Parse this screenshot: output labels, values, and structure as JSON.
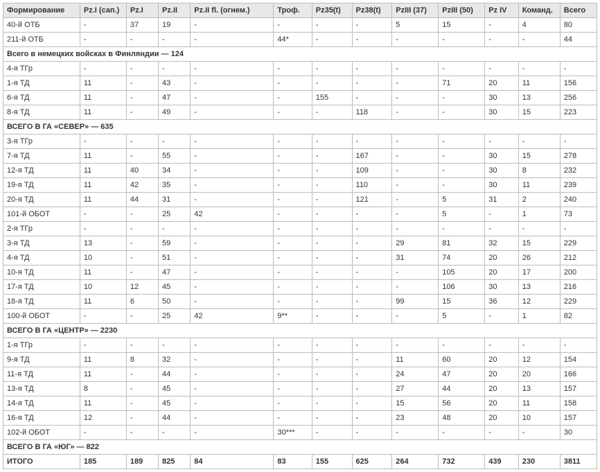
{
  "chart_data": {
    "type": "table",
    "columns": [
      "Формирование",
      "Pz.I (сап.)",
      "Pz.I",
      "Pz.II",
      "Pz.II fl. (огнем.)",
      "Троф.",
      "Pz35(t)",
      "Pz38(t)",
      "PzIII (37)",
      "PzIII (50)",
      "Pz IV",
      "Команд.",
      "Всего"
    ],
    "rows": [
      {
        "t": "d",
        "v": [
          "40-й ОТБ",
          "-",
          "37",
          "19",
          "-",
          "-",
          "-",
          "-",
          "5",
          "15",
          "-",
          "4",
          "80"
        ]
      },
      {
        "t": "d",
        "v": [
          "211-й ОТБ",
          "-",
          "-",
          "-",
          "-",
          "44*",
          "-",
          "-",
          "-",
          "-",
          "-",
          "-",
          "44"
        ]
      },
      {
        "t": "s",
        "label": "Всего в немецких войсках в Финляндии — 124"
      },
      {
        "t": "d",
        "v": [
          "4-я ТГр",
          "-",
          "-",
          "-",
          "-",
          "-",
          "-",
          "-",
          "-",
          "-",
          "-",
          "-",
          "-"
        ]
      },
      {
        "t": "d",
        "v": [
          "1-я ТД",
          "11",
          "-",
          "43",
          "-",
          "-",
          "-",
          "-",
          "-",
          "71",
          "20",
          "11",
          "156"
        ]
      },
      {
        "t": "d",
        "v": [
          "6-я ТД",
          "11",
          "-",
          "47",
          "-",
          "-",
          "155",
          "-",
          "-",
          "-",
          "30",
          "13",
          "256"
        ]
      },
      {
        "t": "d",
        "v": [
          "8-я ТД",
          "11",
          "-",
          "49",
          "-",
          "-",
          "-",
          "118",
          "-",
          "-",
          "30",
          "15",
          "223"
        ]
      },
      {
        "t": "s",
        "label": "ВСЕГО В ГА «СЕВЕР» — 635"
      },
      {
        "t": "d",
        "v": [
          "3-я ТГр",
          "-",
          "-",
          "-",
          "-",
          "-",
          "-",
          "-",
          "-",
          "-",
          "-",
          "-",
          "-"
        ]
      },
      {
        "t": "d",
        "v": [
          "7-я ТД",
          "11",
          "-",
          "55",
          "-",
          "-",
          "-",
          "167",
          "-",
          "-",
          "30",
          "15",
          "278"
        ]
      },
      {
        "t": "d",
        "v": [
          "12-я ТД",
          "11",
          "40",
          "34",
          "-",
          "-",
          "-",
          "109",
          "-",
          "-",
          "30",
          "8",
          "232"
        ]
      },
      {
        "t": "d",
        "v": [
          "19-я ТД",
          "11",
          "42",
          "35",
          "-",
          "-",
          "-",
          "110",
          "-",
          "-",
          "30",
          "11",
          "239"
        ]
      },
      {
        "t": "d",
        "v": [
          "20-я ТД",
          "11",
          "44",
          "31",
          "-",
          "-",
          "-",
          "121",
          "-",
          "5",
          "31",
          "2",
          "240"
        ]
      },
      {
        "t": "d",
        "v": [
          "101-й ОБОТ",
          "-",
          "-",
          "25",
          "42",
          "-",
          "-",
          "-",
          "-",
          "5",
          "-",
          "1",
          "73"
        ]
      },
      {
        "t": "d",
        "v": [
          "2-я ТГр",
          "-",
          "-",
          "-",
          "-",
          "-",
          "-",
          "-",
          "-",
          "-",
          "-",
          "-",
          "-"
        ]
      },
      {
        "t": "d",
        "v": [
          "3-я ТД",
          "13",
          "-",
          "59",
          "-",
          "-",
          "-",
          "-",
          "29",
          "81",
          "32",
          "15",
          "229"
        ]
      },
      {
        "t": "d",
        "v": [
          "4-я ТД",
          "10",
          "-",
          "51",
          "-",
          "-",
          "-",
          "-",
          "31",
          "74",
          "20",
          "26",
          "212"
        ]
      },
      {
        "t": "d",
        "v": [
          "10-я ТД",
          "11",
          "-",
          "47",
          "-",
          "-",
          "-",
          "-",
          "-",
          "105",
          "20",
          "17",
          "200"
        ]
      },
      {
        "t": "d",
        "v": [
          "17-я ТД",
          "10",
          "12",
          "45",
          "-",
          "-",
          "-",
          "-",
          "-",
          "106",
          "30",
          "13",
          "216"
        ]
      },
      {
        "t": "d",
        "v": [
          "18-я ТД",
          "11",
          "6",
          "50",
          "-",
          "-",
          "-",
          "-",
          "99",
          "15",
          "36",
          "12",
          "229"
        ]
      },
      {
        "t": "d",
        "v": [
          "100-й ОБОТ",
          "-",
          "-",
          "25",
          "42",
          "9**",
          "-",
          "-",
          "-",
          "5",
          "-",
          "1",
          "82"
        ]
      },
      {
        "t": "s",
        "label": "ВСЕГО В ГА «ЦЕНТР» — 2230"
      },
      {
        "t": "d",
        "v": [
          "1-я ТГр",
          "-",
          "-",
          "-",
          "-",
          "-",
          "-",
          "-",
          "-",
          "-",
          "-",
          "-",
          "-"
        ]
      },
      {
        "t": "d",
        "v": [
          "9-я ТД",
          "11",
          "8",
          "32",
          "-",
          "-",
          "-",
          "-",
          "11",
          "60",
          "20",
          "12",
          "154"
        ]
      },
      {
        "t": "d",
        "v": [
          "11-я ТД",
          "11",
          "-",
          "44",
          "-",
          "-",
          "-",
          "-",
          "24",
          "47",
          "20",
          "20",
          "166"
        ]
      },
      {
        "t": "d",
        "v": [
          "13-я ТД",
          "8",
          "-",
          "45",
          "-",
          "-",
          "-",
          "-",
          "27",
          "44",
          "20",
          "13",
          "157"
        ]
      },
      {
        "t": "d",
        "v": [
          "14-я ТД",
          "11",
          "-",
          "45",
          "-",
          "-",
          "-",
          "-",
          "15",
          "56",
          "20",
          "11",
          "158"
        ]
      },
      {
        "t": "d",
        "v": [
          "16-я ТД",
          "12",
          "-",
          "44",
          "-",
          "-",
          "-",
          "-",
          "23",
          "48",
          "20",
          "10",
          "157"
        ]
      },
      {
        "t": "d",
        "v": [
          "102-й ОБОТ",
          "-",
          "-",
          "-",
          "-",
          "30***",
          "-",
          "-",
          "-",
          "-",
          "-",
          "-",
          "30"
        ]
      },
      {
        "t": "s",
        "label": "ВСЕГО В ГА «ЮГ» — 822"
      },
      {
        "t": "total",
        "v": [
          "ИТОГО",
          "185",
          "189",
          "825",
          "84",
          "83",
          "155",
          "625",
          "264",
          "732",
          "439",
          "230",
          "3811"
        ]
      }
    ]
  }
}
